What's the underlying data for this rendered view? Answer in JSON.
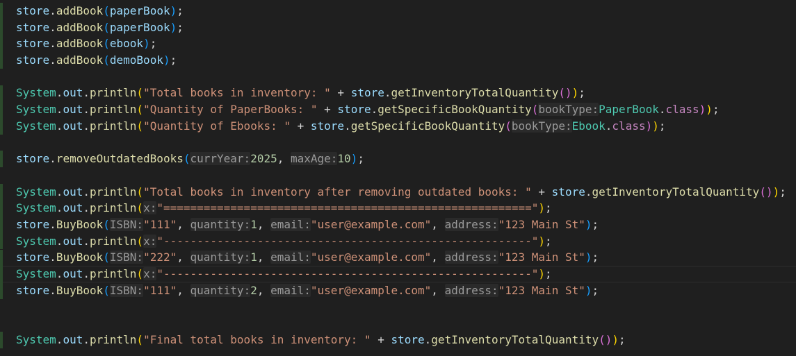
{
  "colors": {
    "background": "#1f1f1f",
    "variable": "#9cdcfe",
    "function": "#dcdcaa",
    "class": "#4ec9b0",
    "string": "#ce9178",
    "number": "#b5cea8",
    "keyword": "#c586c0",
    "inlay_hint": "#9a9a9a",
    "bracket1": "#ffd700",
    "bracket2": "#da70d6",
    "bracket3": "#179fff"
  },
  "editor": {
    "lines": [
      {
        "gutter": true,
        "tokens": [
          [
            "store",
            "t-var"
          ],
          [
            ".",
            "t-punc"
          ],
          [
            "addBook",
            "t-fn"
          ],
          [
            "(",
            "t-b3"
          ],
          [
            "paperBook",
            "t-var"
          ],
          [
            ")",
            "t-b3"
          ],
          [
            ";",
            "t-punc"
          ]
        ]
      },
      {
        "gutter": true,
        "tokens": [
          [
            "store",
            "t-var"
          ],
          [
            ".",
            "t-punc"
          ],
          [
            "addBook",
            "t-fn"
          ],
          [
            "(",
            "t-b3"
          ],
          [
            "paperBook",
            "t-var"
          ],
          [
            ")",
            "t-b3"
          ],
          [
            ";",
            "t-punc"
          ]
        ]
      },
      {
        "gutter": true,
        "tokens": [
          [
            "store",
            "t-var"
          ],
          [
            ".",
            "t-punc"
          ],
          [
            "addBook",
            "t-fn"
          ],
          [
            "(",
            "t-b3"
          ],
          [
            "ebook",
            "t-var"
          ],
          [
            ")",
            "t-b3"
          ],
          [
            ";",
            "t-punc"
          ]
        ]
      },
      {
        "gutter": true,
        "tokens": [
          [
            "store",
            "t-var"
          ],
          [
            ".",
            "t-punc"
          ],
          [
            "addBook",
            "t-fn"
          ],
          [
            "(",
            "t-b3"
          ],
          [
            "demoBook",
            "t-var"
          ],
          [
            ")",
            "t-b3"
          ],
          [
            ";",
            "t-punc"
          ]
        ]
      },
      {
        "gutter": false,
        "tokens": []
      },
      {
        "gutter": true,
        "tokens": [
          [
            "System",
            "t-cls"
          ],
          [
            ".",
            "t-punc"
          ],
          [
            "out",
            "t-var"
          ],
          [
            ".",
            "t-punc"
          ],
          [
            "println",
            "t-fn"
          ],
          [
            "(",
            "t-b1"
          ],
          [
            "\"Total books in inventory: \"",
            "t-str"
          ],
          [
            " + ",
            "t-punc"
          ],
          [
            "store",
            "t-var"
          ],
          [
            ".",
            "t-punc"
          ],
          [
            "getInventoryTotalQuantity",
            "t-fn"
          ],
          [
            "(",
            "t-b2"
          ],
          [
            ")",
            "t-b2"
          ],
          [
            ")",
            "t-b1"
          ],
          [
            ";",
            "t-punc"
          ]
        ]
      },
      {
        "gutter": true,
        "tokens": [
          [
            "System",
            "t-cls"
          ],
          [
            ".",
            "t-punc"
          ],
          [
            "out",
            "t-var"
          ],
          [
            ".",
            "t-punc"
          ],
          [
            "println",
            "t-fn"
          ],
          [
            "(",
            "t-b1"
          ],
          [
            "\"Quantity of PaperBooks: \"",
            "t-str"
          ],
          [
            " + ",
            "t-punc"
          ],
          [
            "store",
            "t-var"
          ],
          [
            ".",
            "t-punc"
          ],
          [
            "getSpecificBookQuantity",
            "t-fn"
          ],
          [
            "(",
            "t-b2"
          ],
          [
            "bookType:",
            "t-hint"
          ],
          [
            "PaperBook",
            "t-cls"
          ],
          [
            ".",
            "t-punc"
          ],
          [
            "class",
            "t-kw"
          ],
          [
            ")",
            "t-b2"
          ],
          [
            ")",
            "t-b1"
          ],
          [
            ";",
            "t-punc"
          ]
        ]
      },
      {
        "gutter": true,
        "tokens": [
          [
            "System",
            "t-cls"
          ],
          [
            ".",
            "t-punc"
          ],
          [
            "out",
            "t-var"
          ],
          [
            ".",
            "t-punc"
          ],
          [
            "println",
            "t-fn"
          ],
          [
            "(",
            "t-b1"
          ],
          [
            "\"Quantity of Ebooks: \"",
            "t-str"
          ],
          [
            " + ",
            "t-punc"
          ],
          [
            "store",
            "t-var"
          ],
          [
            ".",
            "t-punc"
          ],
          [
            "getSpecificBookQuantity",
            "t-fn"
          ],
          [
            "(",
            "t-b2"
          ],
          [
            "bookType:",
            "t-hint"
          ],
          [
            "Ebook",
            "t-cls"
          ],
          [
            ".",
            "t-punc"
          ],
          [
            "class",
            "t-kw"
          ],
          [
            ")",
            "t-b2"
          ],
          [
            ")",
            "t-b1"
          ],
          [
            ";",
            "t-punc"
          ]
        ]
      },
      {
        "gutter": false,
        "tokens": []
      },
      {
        "gutter": true,
        "tokens": [
          [
            "store",
            "t-var"
          ],
          [
            ".",
            "t-punc"
          ],
          [
            "removeOutdatedBooks",
            "t-fn"
          ],
          [
            "(",
            "t-b3"
          ],
          [
            "currYear:",
            "t-hint"
          ],
          [
            "2025",
            "t-num"
          ],
          [
            ", ",
            "t-punc"
          ],
          [
            "maxAge:",
            "t-hint"
          ],
          [
            "10",
            "t-num"
          ],
          [
            ")",
            "t-b3"
          ],
          [
            ";",
            "t-punc"
          ]
        ]
      },
      {
        "gutter": false,
        "tokens": []
      },
      {
        "gutter": true,
        "tokens": [
          [
            "System",
            "t-cls"
          ],
          [
            ".",
            "t-punc"
          ],
          [
            "out",
            "t-var"
          ],
          [
            ".",
            "t-punc"
          ],
          [
            "println",
            "t-fn"
          ],
          [
            "(",
            "t-b1"
          ],
          [
            "\"Total books in inventory after removing outdated books: \"",
            "t-str"
          ],
          [
            " + ",
            "t-punc"
          ],
          [
            "store",
            "t-var"
          ],
          [
            ".",
            "t-punc"
          ],
          [
            "getInventoryTotalQuantity",
            "t-fn"
          ],
          [
            "(",
            "t-b2"
          ],
          [
            ")",
            "t-b2"
          ],
          [
            ")",
            "t-b1"
          ],
          [
            ";",
            "t-punc"
          ]
        ]
      },
      {
        "gutter": true,
        "tokens": [
          [
            "System",
            "t-cls"
          ],
          [
            ".",
            "t-punc"
          ],
          [
            "out",
            "t-var"
          ],
          [
            ".",
            "t-punc"
          ],
          [
            "println",
            "t-fn"
          ],
          [
            "(",
            "t-b1"
          ],
          [
            "x:",
            "t-hint"
          ],
          [
            "\"=======================================================\"",
            "t-str"
          ],
          [
            ")",
            "t-b1"
          ],
          [
            ";",
            "t-punc"
          ]
        ]
      },
      {
        "gutter": true,
        "tokens": [
          [
            "store",
            "t-var"
          ],
          [
            ".",
            "t-punc"
          ],
          [
            "BuyBook",
            "t-fn"
          ],
          [
            "(",
            "t-b3"
          ],
          [
            "ISBN:",
            "t-hint"
          ],
          [
            "\"111\"",
            "t-str"
          ],
          [
            ", ",
            "t-punc"
          ],
          [
            "quantity:",
            "t-hint"
          ],
          [
            "1",
            "t-num"
          ],
          [
            ", ",
            "t-punc"
          ],
          [
            "email:",
            "t-hint"
          ],
          [
            "\"user@example.com\"",
            "t-str"
          ],
          [
            ", ",
            "t-punc"
          ],
          [
            "address:",
            "t-hint"
          ],
          [
            "\"123 Main St\"",
            "t-str"
          ],
          [
            ")",
            "t-b3"
          ],
          [
            ";",
            "t-punc"
          ]
        ]
      },
      {
        "gutter": true,
        "tokens": [
          [
            "System",
            "t-cls"
          ],
          [
            ".",
            "t-punc"
          ],
          [
            "out",
            "t-var"
          ],
          [
            ".",
            "t-punc"
          ],
          [
            "println",
            "t-fn"
          ],
          [
            "(",
            "t-b1"
          ],
          [
            "x:",
            "t-hint"
          ],
          [
            "\"-------------------------------------------------------\"",
            "t-str"
          ],
          [
            ")",
            "t-b1"
          ],
          [
            ";",
            "t-punc"
          ]
        ]
      },
      {
        "gutter": true,
        "tokens": [
          [
            "store",
            "t-var"
          ],
          [
            ".",
            "t-punc"
          ],
          [
            "BuyBook",
            "t-fn"
          ],
          [
            "(",
            "t-b3"
          ],
          [
            "ISBN:",
            "t-hint"
          ],
          [
            "\"222\"",
            "t-str"
          ],
          [
            ", ",
            "t-punc"
          ],
          [
            "quantity:",
            "t-hint"
          ],
          [
            "1",
            "t-num"
          ],
          [
            ", ",
            "t-punc"
          ],
          [
            "email:",
            "t-hint"
          ],
          [
            "\"user@example.com\"",
            "t-str"
          ],
          [
            ", ",
            "t-punc"
          ],
          [
            "address:",
            "t-hint"
          ],
          [
            "\"123 Main St\"",
            "t-str"
          ],
          [
            ")",
            "t-b3"
          ],
          [
            ";",
            "t-punc"
          ]
        ]
      },
      {
        "gutter": true,
        "current": true,
        "tokens": [
          [
            "System",
            "t-cls"
          ],
          [
            ".",
            "t-punc"
          ],
          [
            "out",
            "t-var"
          ],
          [
            ".",
            "t-punc"
          ],
          [
            "println",
            "t-fn"
          ],
          [
            "(",
            "t-b1"
          ],
          [
            "x:",
            "t-hint"
          ],
          [
            "\"-------------------------------------------------------\"",
            "t-str"
          ],
          [
            ")",
            "t-b1"
          ],
          [
            ";",
            "t-punc"
          ]
        ]
      },
      {
        "gutter": true,
        "tokens": [
          [
            "store",
            "t-var"
          ],
          [
            ".",
            "t-punc"
          ],
          [
            "BuyBook",
            "t-fn"
          ],
          [
            "(",
            "t-b3"
          ],
          [
            "ISBN:",
            "t-hint"
          ],
          [
            "\"111\"",
            "t-str"
          ],
          [
            ", ",
            "t-punc"
          ],
          [
            "quantity:",
            "t-hint"
          ],
          [
            "2",
            "t-num"
          ],
          [
            ", ",
            "t-punc"
          ],
          [
            "email:",
            "t-hint"
          ],
          [
            "\"user@example.com\"",
            "t-str"
          ],
          [
            ", ",
            "t-punc"
          ],
          [
            "address:",
            "t-hint"
          ],
          [
            "\"123 Main St\"",
            "t-str"
          ],
          [
            ")",
            "t-b3"
          ],
          [
            ";",
            "t-punc"
          ]
        ]
      },
      {
        "gutter": false,
        "tokens": []
      },
      {
        "gutter": false,
        "tokens": []
      },
      {
        "gutter": true,
        "tokens": [
          [
            "System",
            "t-cls"
          ],
          [
            ".",
            "t-punc"
          ],
          [
            "out",
            "t-var"
          ],
          [
            ".",
            "t-punc"
          ],
          [
            "println",
            "t-fn"
          ],
          [
            "(",
            "t-b1"
          ],
          [
            "\"Final total books in inventory: \"",
            "t-str"
          ],
          [
            " + ",
            "t-punc"
          ],
          [
            "store",
            "t-var"
          ],
          [
            ".",
            "t-punc"
          ],
          [
            "getInventoryTotalQuantity",
            "t-fn"
          ],
          [
            "(",
            "t-b2"
          ],
          [
            ")",
            "t-b2"
          ],
          [
            ")",
            "t-b1"
          ],
          [
            ";",
            "t-punc"
          ]
        ]
      }
    ]
  }
}
